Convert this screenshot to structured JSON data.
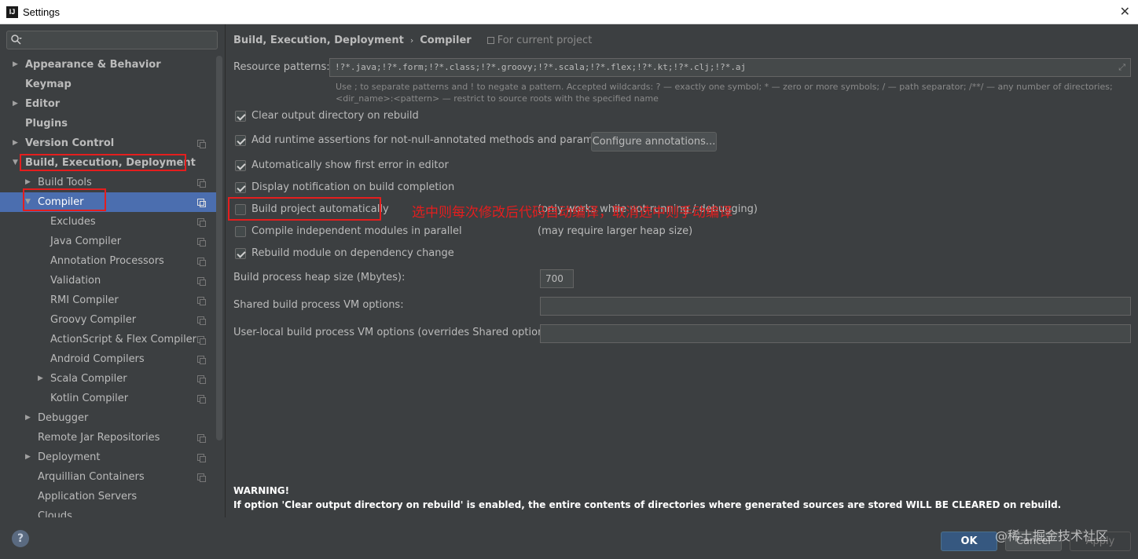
{
  "window": {
    "title": "Settings",
    "app_icon": "IJ",
    "close": "✕"
  },
  "sidebar": {
    "items": [
      {
        "label": "Appearance & Behavior",
        "bold": true,
        "arrow": "▶",
        "proj": false
      },
      {
        "label": "Keymap",
        "bold": true,
        "arrow": "",
        "proj": false
      },
      {
        "label": "Editor",
        "bold": true,
        "arrow": "▶",
        "proj": false
      },
      {
        "label": "Plugins",
        "bold": true,
        "arrow": "",
        "proj": false
      },
      {
        "label": "Version Control",
        "bold": true,
        "arrow": "▶",
        "proj": true
      },
      {
        "label": "Build, Execution, Deployment",
        "bold": true,
        "arrow": "▼",
        "proj": false
      },
      {
        "label": "Build Tools",
        "bold": false,
        "arrow": "▶",
        "proj": true
      },
      {
        "label": "Compiler",
        "bold": false,
        "arrow": "▼",
        "proj": true,
        "selected": true
      },
      {
        "label": "Excludes",
        "bold": false,
        "arrow": "",
        "proj": true
      },
      {
        "label": "Java Compiler",
        "bold": false,
        "arrow": "",
        "proj": true
      },
      {
        "label": "Annotation Processors",
        "bold": false,
        "arrow": "",
        "proj": true
      },
      {
        "label": "Validation",
        "bold": false,
        "arrow": "",
        "proj": true
      },
      {
        "label": "RMI Compiler",
        "bold": false,
        "arrow": "",
        "proj": true
      },
      {
        "label": "Groovy Compiler",
        "bold": false,
        "arrow": "",
        "proj": true
      },
      {
        "label": "ActionScript & Flex Compiler",
        "bold": false,
        "arrow": "",
        "proj": true
      },
      {
        "label": "Android Compilers",
        "bold": false,
        "arrow": "",
        "proj": true
      },
      {
        "label": "Scala Compiler",
        "bold": false,
        "arrow": "▶",
        "proj": true
      },
      {
        "label": "Kotlin Compiler",
        "bold": false,
        "arrow": "",
        "proj": true
      },
      {
        "label": "Debugger",
        "bold": false,
        "arrow": "▶",
        "proj": false
      },
      {
        "label": "Remote Jar Repositories",
        "bold": false,
        "arrow": "",
        "proj": true
      },
      {
        "label": "Deployment",
        "bold": false,
        "arrow": "▶",
        "proj": true
      },
      {
        "label": "Arquillian Containers",
        "bold": false,
        "arrow": "",
        "proj": true
      },
      {
        "label": "Application Servers",
        "bold": false,
        "arrow": "",
        "proj": false
      },
      {
        "label": "Clouds",
        "bold": false,
        "arrow": "",
        "proj": false
      }
    ]
  },
  "breadcrumb": {
    "parent": "Build, Execution, Deployment",
    "separator": "›",
    "current": "Compiler",
    "scope": "For current project"
  },
  "resource_patterns": {
    "label": "Resource patterns:",
    "value": "!?*.java;!?*.form;!?*.class;!?*.groovy;!?*.scala;!?*.flex;!?*.kt;!?*.clj;!?*.aj",
    "hint": "Use ; to separate patterns and ! to negate a pattern. Accepted wildcards: ? — exactly one symbol; * — zero or more symbols; / — path separator; /**/ — any number of directories; <dir_name>:<pattern> — restrict to source roots with the specified name"
  },
  "options": {
    "clear_output": {
      "label": "Clear output directory on rebuild",
      "checked": true
    },
    "runtime_assertions": {
      "label": "Add runtime assertions for not-null-annotated methods and parameters",
      "checked": true
    },
    "configure_annotations": "Configure annotations...",
    "show_first_error": {
      "label": "Automatically show first error in editor",
      "checked": true
    },
    "display_notification": {
      "label": "Display notification on build completion",
      "checked": true
    },
    "build_automatically": {
      "label": "Build project automatically",
      "checked": false,
      "note": "(only works while not running / debugging)"
    },
    "compile_parallel": {
      "label": "Compile independent modules in parallel",
      "checked": false,
      "note": "(may require larger heap size)"
    },
    "rebuild_on_dependency": {
      "label": "Rebuild module on dependency change",
      "checked": true
    }
  },
  "heap": {
    "label": "Build process heap size (Mbytes):",
    "value": "700"
  },
  "shared_vm": {
    "label": "Shared build process VM options:",
    "value": ""
  },
  "user_vm": {
    "label": "User-local build process VM options (overrides Shared options):",
    "value": ""
  },
  "annotation": "选中则每次修改后代码自动编译，取消选中则手动编译",
  "warning": {
    "title": "WARNING!",
    "text": "If option 'Clear output directory on rebuild' is enabled, the entire contents of directories where generated sources are stored WILL BE CLEARED on rebuild."
  },
  "buttons": {
    "help": "?",
    "ok": "OK",
    "cancel": "Cancel",
    "apply": "Apply"
  },
  "watermark": "@稀土掘金技术社区",
  "colors": {
    "accent_selected": "#4b6eaf",
    "highlight_box": "#e41e1e",
    "ok_button": "#365880"
  }
}
